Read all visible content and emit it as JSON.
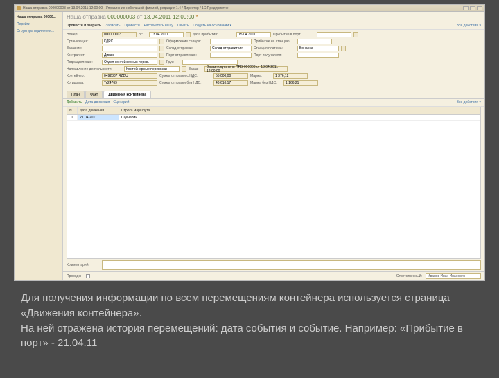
{
  "window": {
    "title": "Наша отправка 000000003 от 13.04.2011 12:00:00 - Управление небольшой фирмой, редакция 1.4 / Директор / 1С:Предприятие"
  },
  "sidebar": {
    "items": [
      "Наша отправка 00000...",
      "Перейти",
      "Структура подчинени..."
    ]
  },
  "doc": {
    "title_prefix": "Наша отправка",
    "number": "000000003",
    "from": "от",
    "date_full": "13.04.2011 12:00:00",
    "star": "*"
  },
  "toolbar": {
    "run_close": "Провести и закрыть",
    "save": "Записать",
    "run": "Провести",
    "print_my": "Распечатать нашу",
    "print": "Печать",
    "create_on": "Создать на основании ▾",
    "all_actions": "Все действия ▾"
  },
  "form": {
    "number_lbl": "Номер:",
    "number": "000000003",
    "from_lbl": "от:",
    "from": "13.04.2011",
    "arrival_date_lbl": "Дата прибытия:",
    "arrival_date": "15.04.2011",
    "port_arrival_lbl": "Прибытие в порт:",
    "org_lbl": "Организация:",
    "org": "КДРС",
    "warehouse_lbl": "Оформление склада:",
    "station_arrival_lbl": "Прибытие на станцию:",
    "customer_lbl": "Заказчик:",
    "sender_warehouse_lbl": "Склад отправки:",
    "sender_warehouse": "Склад отправителя",
    "payment_station_lbl": "Станция платежа:",
    "payment_station": "Бонанса",
    "counterparty_lbl": "Контрагент:",
    "counterparty": "Диван",
    "sender_port_lbl": "Порт отправления:",
    "recipient_port_lbl": "Порт получателя:",
    "division_lbl": "Подразделение:",
    "division": "Отдел контейнерных перев.",
    "cargo_lbl": "Груз:",
    "activity_lbl": "Направление деятельности:",
    "activity": "Контейнерные перевозки",
    "order_lbl": "Заказ:",
    "order": "Заказ покупателя ПРВ-000003 от 13.04.2011 12:00:00",
    "container_lbl": "Контейнер:",
    "container": "0492887 RZDU",
    "sum_vat_lbl": "Сумма отправки с НДС:",
    "sum_vat": "55 000,00",
    "margin_lbl": "Маржа:",
    "margin": "1 376,12",
    "quote_lbl": "Котировка:",
    "quote": "Тк24769",
    "sum_novat_lbl": "Сумма отправки без НДС:",
    "sum_novat": "46 610,17",
    "margin_novat_lbl": "Маржа без НДС:",
    "margin_novat": "1 166,21"
  },
  "tabs": {
    "plan": "План",
    "fact": "Факт",
    "moves": "Движения контейнера"
  },
  "tabtools": {
    "add": "Добавить",
    "date_ev": "Дата движения",
    "scenario": "Сценарий",
    "all_actions": "Все действия ▾"
  },
  "grid": {
    "h1": "N",
    "h2": "Дата движения",
    "h3": "Строка маршрута",
    "row1": {
      "n": "1",
      "date": "21.04.2011",
      "route": "Сценарий"
    }
  },
  "comment_lbl": "Комментарий:",
  "footer": {
    "done": "Проведен",
    "resp": "Ответственный:",
    "name": "Иванов Иван Иванович"
  },
  "caption": {
    "l1": "Для получения информации по всем перемещениям контейнера используется страница «Движения контейнера».",
    "l2": "На ней отражена история перемещений: дата события и событие. Например: «Прибытие в порт» - 21.04.11"
  }
}
